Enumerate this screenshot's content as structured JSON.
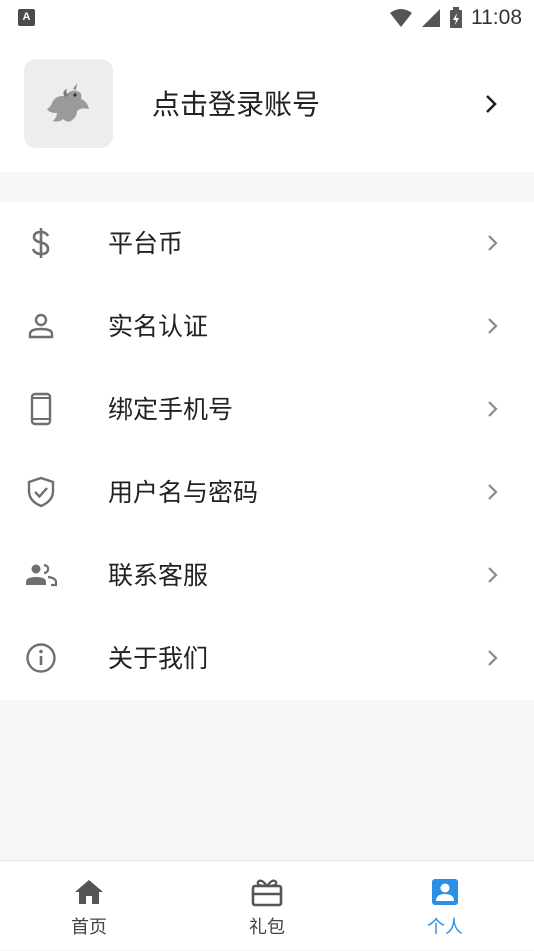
{
  "status_bar": {
    "left_icon": "A",
    "time": "11:08"
  },
  "profile": {
    "login_label": "点击登录账号",
    "avatar_icon": "unicorn-avatar-icon"
  },
  "menu": {
    "items": [
      {
        "label": "平台币",
        "icon": "dollar-icon"
      },
      {
        "label": "实名认证",
        "icon": "person-icon"
      },
      {
        "label": "绑定手机号",
        "icon": "phone-icon"
      },
      {
        "label": "用户名与密码",
        "icon": "shield-check-icon"
      },
      {
        "label": "联系客服",
        "icon": "people-icon"
      },
      {
        "label": "关于我们",
        "icon": "info-icon"
      }
    ]
  },
  "tabbar": {
    "tabs": [
      {
        "label": "首页",
        "icon": "home-icon",
        "active": false
      },
      {
        "label": "礼包",
        "icon": "gift-icon",
        "active": false
      },
      {
        "label": "个人",
        "icon": "profile-card-icon",
        "active": true
      }
    ]
  },
  "colors": {
    "accent": "#2b8fe6",
    "icon_gray": "#7a7a7a",
    "background": "#f7f7f7"
  }
}
